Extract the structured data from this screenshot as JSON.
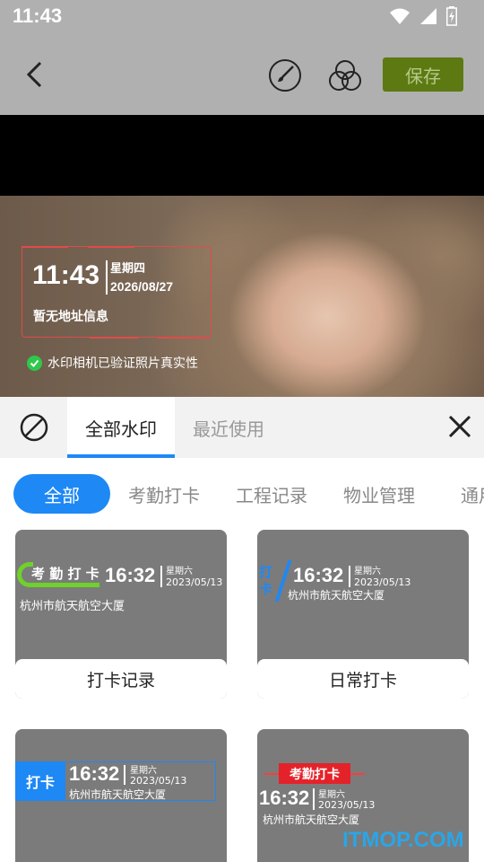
{
  "status_bar": {
    "time": "11:43"
  },
  "toolbar": {
    "save_label": "保存"
  },
  "preview": {
    "time": "11:43",
    "weekday": "星期四",
    "date": "2026/08/27",
    "address": "暂无地址信息",
    "verified_text": "水印相机已验证照片真实性"
  },
  "tabs": {
    "all": "全部水印",
    "recent": "最近使用"
  },
  "categories": [
    "全部",
    "考勤打卡",
    "工程记录",
    "物业管理",
    "通用"
  ],
  "cards": [
    {
      "label": "打卡记录",
      "badge": "考 勤 打 卡",
      "time": "16:32",
      "weekday": "星期六",
      "date": "2023/05/13",
      "address": "杭州市航天航空大厦"
    },
    {
      "label": "日常打卡",
      "badge": "打卡",
      "time": "16:32",
      "weekday": "星期六",
      "date": "2023/05/13",
      "address": "杭州市航天航空大厦"
    },
    {
      "label": "",
      "badge": "打卡",
      "time": "16:32",
      "weekday": "星期六",
      "date": "2023/05/13",
      "address": "杭州市航天航空大厦"
    },
    {
      "label": "",
      "badge": "考勤打卡",
      "time": "16:32",
      "weekday": "星期六",
      "date": "2023/05/13",
      "address": "杭州市航天航空大厦"
    }
  ],
  "site_watermark": "ITMOP.COM",
  "colors": {
    "accent": "#1e88f5",
    "save_bg": "#5d7a12",
    "frame_red": "#e04b4b",
    "verified_green": "#2ec84a"
  }
}
